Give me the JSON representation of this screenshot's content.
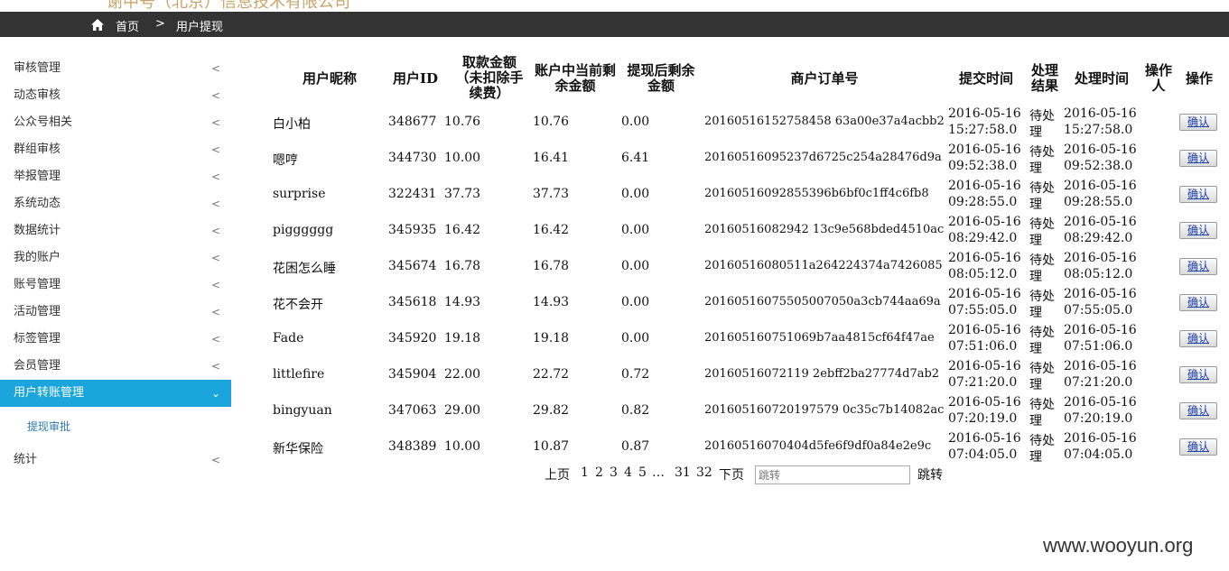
{
  "header": {
    "brand_text": "谢中号（北京）信息技术有限公司"
  },
  "breadcrumb": {
    "home": "首页",
    "separator": ">",
    "current": "用户提现"
  },
  "sidebar": {
    "items": [
      {
        "label": "审核管理"
      },
      {
        "label": "动态审核"
      },
      {
        "label": "公众号相关"
      },
      {
        "label": "群组审核"
      },
      {
        "label": "举报管理"
      },
      {
        "label": "系统动态"
      },
      {
        "label": "数据统计"
      },
      {
        "label": "我的账户"
      },
      {
        "label": "账号管理"
      },
      {
        "label": "活动管理"
      },
      {
        "label": "标签管理"
      },
      {
        "label": "会员管理"
      }
    ],
    "active_item": {
      "label": "用户转账管理"
    },
    "sub_item": {
      "label": "提现审批"
    },
    "last_item": {
      "label": "统计"
    }
  },
  "table": {
    "headers": [
      "用户昵称",
      "用户ID",
      "取款金额（未扣除手续费）",
      "账户中当前剩余金额",
      "提现后剩余金额",
      "商户订单号",
      "提交时间",
      "处理结果",
      "处理时间",
      "操作人",
      "操作"
    ],
    "rows": [
      {
        "nickname": "白小柏",
        "user_id": "348677",
        "amount": "10.76",
        "balance": "10.76",
        "after": "0.00",
        "order_no": "20160516152758458 63a00e37a4acbb2",
        "submit_date": "2016-05-16",
        "submit_time": "15:27:58.0",
        "result_a": "待处",
        "result_b": "理",
        "handle_date": "2016-05-16",
        "handle_time": "15:27:58.0",
        "action": "确认"
      },
      {
        "nickname": "嗯哼",
        "user_id": "344730",
        "amount": "10.00",
        "balance": "16.41",
        "after": "6.41",
        "order_no": "20160516095237d6725c254a28476d9a",
        "submit_date": "2016-05-16",
        "submit_time": "09:52:38.0",
        "result_a": "待处",
        "result_b": "理",
        "handle_date": "2016-05-16",
        "handle_time": "09:52:38.0",
        "action": "确认"
      },
      {
        "nickname": "surprise",
        "user_id": "322431",
        "amount": "37.73",
        "balance": "37.73",
        "after": "0.00",
        "order_no": "20160516092855396b6bf0c1ff4c6fb8",
        "submit_date": "2016-05-16",
        "submit_time": "09:28:55.0",
        "result_a": "待处",
        "result_b": "理",
        "handle_date": "2016-05-16",
        "handle_time": "09:28:55.0",
        "action": "确认"
      },
      {
        "nickname": "pigggggg",
        "user_id": "345935",
        "amount": "16.42",
        "balance": "16.42",
        "after": "0.00",
        "order_no": "20160516082942 13c9e568bded4510ac",
        "submit_date": "2016-05-16",
        "submit_time": "08:29:42.0",
        "result_a": "待处",
        "result_b": "理",
        "handle_date": "2016-05-16",
        "handle_time": "08:29:42.0",
        "action": "确认"
      },
      {
        "nickname": "花困怎么睡",
        "user_id": "345674",
        "amount": "16.78",
        "balance": "16.78",
        "after": "0.00",
        "order_no": "20160516080511a264224374a7426085",
        "submit_date": "2016-05-16",
        "submit_time": "08:05:12.0",
        "result_a": "待处",
        "result_b": "理",
        "handle_date": "2016-05-16",
        "handle_time": "08:05:12.0",
        "action": "确认"
      },
      {
        "nickname": "花不会开",
        "user_id": "345618",
        "amount": "14.93",
        "balance": "14.93",
        "after": "0.00",
        "order_no": "20160516075505007050a3cb744aa69a",
        "submit_date": "2016-05-16",
        "submit_time": "07:55:05.0",
        "result_a": "待处",
        "result_b": "理",
        "handle_date": "2016-05-16",
        "handle_time": "07:55:05.0",
        "action": "确认"
      },
      {
        "nickname": "Fade",
        "user_id": "345920",
        "amount": "19.18",
        "balance": "19.18",
        "after": "0.00",
        "order_no": "201605160751069b7aa4815cf64f47ae",
        "submit_date": "2016-05-16",
        "submit_time": "07:51:06.0",
        "result_a": "待处",
        "result_b": "理",
        "handle_date": "2016-05-16",
        "handle_time": "07:51:06.0",
        "action": "确认"
      },
      {
        "nickname": "littlefire",
        "user_id": "345904",
        "amount": "22.00",
        "balance": "22.72",
        "after": "0.72",
        "order_no": "20160516072119 2ebff2ba27774d7ab2",
        "submit_date": "2016-05-16",
        "submit_time": "07:21:20.0",
        "result_a": "待处",
        "result_b": "理",
        "handle_date": "2016-05-16",
        "handle_time": "07:21:20.0",
        "action": "确认"
      },
      {
        "nickname": "bingyuan",
        "user_id": "347063",
        "amount": "29.00",
        "balance": "29.82",
        "after": "0.82",
        "order_no": "201605160720197579 0c35c7b14082ac",
        "submit_date": "2016-05-16",
        "submit_time": "07:20:19.0",
        "result_a": "待处",
        "result_b": "理",
        "handle_date": "2016-05-16",
        "handle_time": "07:20:19.0",
        "action": "确认"
      },
      {
        "nickname": "新华保险",
        "user_id": "348389",
        "amount": "10.00",
        "balance": "10.87",
        "after": "0.87",
        "order_no": "20160516070404d5fe6f9df0a84e2e9c",
        "submit_date": "2016-05-16",
        "submit_time": "07:04:05.0",
        "result_a": "待处",
        "result_b": "理",
        "handle_date": "2016-05-16",
        "handle_time": "07:04:05.0",
        "action": "确认"
      }
    ]
  },
  "pagination": {
    "prev": "上页",
    "current": "1",
    "pages": [
      "2",
      "3",
      "4",
      "5"
    ],
    "ellipsis": "…",
    "pages_tail": [
      "31",
      "32"
    ],
    "next": "下页",
    "jump_placeholder": "跳转",
    "jump_button": "跳转"
  },
  "watermark": "www.wooyun.org"
}
